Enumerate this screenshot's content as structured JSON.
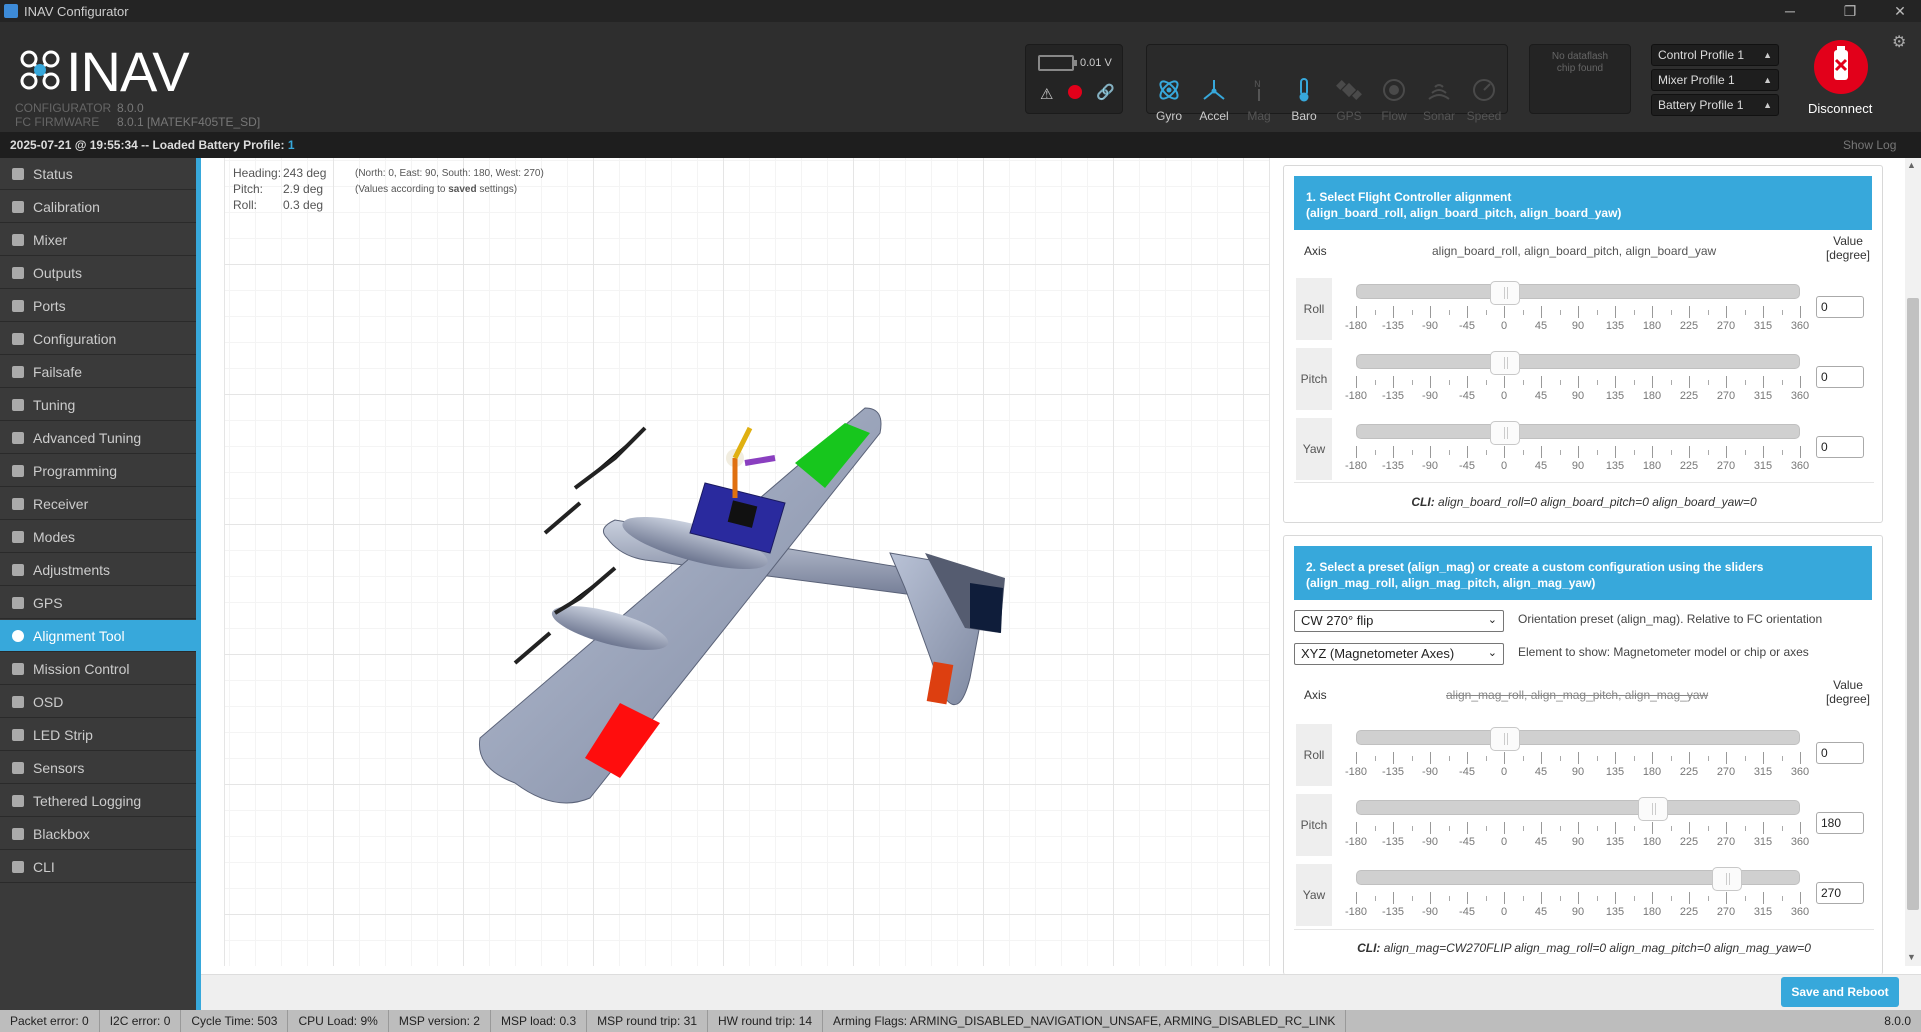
{
  "window": {
    "title": "INAV Configurator",
    "minimize": "─",
    "maximize": "❐",
    "close": "✕"
  },
  "logo": {
    "text": "INAV"
  },
  "versions": {
    "configurator_label": "CONFIGURATOR",
    "configurator_version": "8.0.0",
    "firmware_label": "FC FIRMWARE",
    "firmware_version": "8.0.1 [MATEKF405TE_SD]"
  },
  "battery": {
    "voltage": "0.01 V"
  },
  "sensors": [
    {
      "name": "Gyro",
      "active": true
    },
    {
      "name": "Accel",
      "active": true
    },
    {
      "name": "Mag",
      "active": false
    },
    {
      "name": "Baro",
      "active": true
    },
    {
      "name": "GPS",
      "active": false
    },
    {
      "name": "Flow",
      "active": false
    },
    {
      "name": "Sonar",
      "active": false
    },
    {
      "name": "Speed",
      "active": false
    }
  ],
  "dataflash": {
    "line1": "No dataflash",
    "line2": "chip found"
  },
  "profiles": {
    "control": "Control Profile 1",
    "mixer": "Mixer Profile 1",
    "battery": "Battery Profile 1"
  },
  "disconnect_label": "Disconnect",
  "status": {
    "text": "2025-07-21 @ 19:55:34 -- Loaded Battery Profile: ",
    "profile_num": "1",
    "show_log": "Show Log"
  },
  "nav": [
    "Status",
    "Calibration",
    "Mixer",
    "Outputs",
    "Ports",
    "Configuration",
    "Failsafe",
    "Tuning",
    "Advanced Tuning",
    "Programming",
    "Receiver",
    "Modes",
    "Adjustments",
    "GPS",
    "Alignment Tool",
    "Mission Control",
    "OSD",
    "LED Strip",
    "Sensors",
    "Tethered Logging",
    "Blackbox",
    "CLI"
  ],
  "nav_active": "Alignment Tool",
  "orientation": {
    "heading_label": "Heading:",
    "heading_value": "243 deg",
    "pitch_label": "Pitch:",
    "pitch_value": "2.9 deg",
    "roll_label": "Roll:",
    "roll_value": "0.3 deg",
    "note1": "(North: 0, East: 90, South: 180, West: 270)",
    "note2_pre": "(Values according to ",
    "note2_bold": "saved",
    "note2_post": " settings)"
  },
  "panel1": {
    "title1": "1. Select Flight Controller alignment",
    "title2": "(align_board_roll, align_board_pitch, align_board_yaw)",
    "axis_header": "Axis",
    "params_header": "align_board_roll, align_board_pitch, align_board_yaw",
    "value_header1": "Value",
    "value_header2": "[degree]",
    "rows": [
      {
        "axis": "Roll",
        "value": "0"
      },
      {
        "axis": "Pitch",
        "value": "0"
      },
      {
        "axis": "Yaw",
        "value": "0"
      }
    ],
    "cli_label": "CLI:",
    "cli_text": "align_board_roll=0 align_board_pitch=0 align_board_yaw=0"
  },
  "panel2": {
    "title1": "2. Select a preset (align_mag) or create a custom configuration using the sliders",
    "title2": "(align_mag_roll, align_mag_pitch, align_mag_yaw)",
    "preset_value": "CW 270° flip",
    "preset_desc": "Orientation preset (align_mag). Relative to FC orientation",
    "element_value": "XYZ (Magnetometer Axes)",
    "element_desc": "Element to show: Magnetometer model or chip or axes",
    "axis_header": "Axis",
    "params_header": "align_mag_roll, align_mag_pitch, align_mag_yaw",
    "value_header1": "Value",
    "value_header2": "[degree]",
    "rows": [
      {
        "axis": "Roll",
        "value": "0"
      },
      {
        "axis": "Pitch",
        "value": "180"
      },
      {
        "axis": "Yaw",
        "value": "270"
      }
    ],
    "cli_label": "CLI:",
    "cli_text": "align_mag=CW270FLIP align_mag_roll=0 align_mag_pitch=0 align_mag_yaw=0"
  },
  "tick_labels": [
    "-180",
    "-135",
    "-90",
    "-45",
    "0",
    "45",
    "90",
    "135",
    "180",
    "225",
    "270",
    "315",
    "360"
  ],
  "save_label": "Save and Reboot",
  "bottom": {
    "packet_error": "Packet error: 0",
    "i2c_error": "I2C error: 0",
    "cycle_time": "Cycle Time: 503",
    "cpu_load": "CPU Load: 9%",
    "msp_version": "MSP version: 2",
    "msp_load": "MSP load: 0.3",
    "msp_rt": "MSP round trip: 31",
    "hw_rt": "HW round trip: 14",
    "arming": "Arming Flags: ARMING_DISABLED_NAVIGATION_UNSAFE, ARMING_DISABLED_RC_LINK",
    "version": "8.0.0"
  },
  "colors": {
    "accent": "#37a8db",
    "header_bg": "#2e2e2e",
    "disconnect": "#e2001a"
  }
}
